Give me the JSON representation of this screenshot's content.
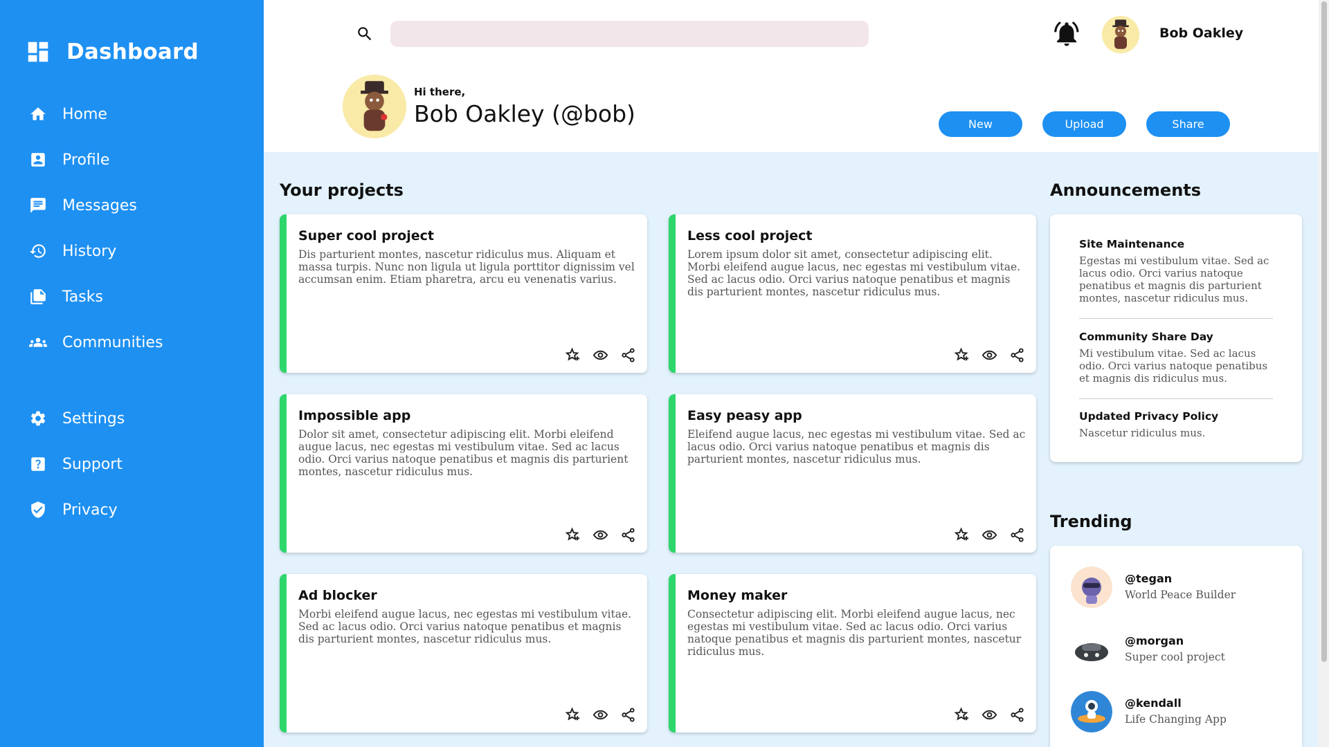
{
  "brand": {
    "title": "Dashboard",
    "icon": "dashboard-icon"
  },
  "sidebar": {
    "items": [
      {
        "label": "Home",
        "icon": "home-icon"
      },
      {
        "label": "Profile",
        "icon": "profile-icon"
      },
      {
        "label": "Messages",
        "icon": "messages-icon"
      },
      {
        "label": "History",
        "icon": "history-icon"
      },
      {
        "label": "Tasks",
        "icon": "tasks-icon"
      },
      {
        "label": "Communities",
        "icon": "communities-icon"
      }
    ],
    "secondary": [
      {
        "label": "Settings",
        "icon": "gear-icon"
      },
      {
        "label": "Support",
        "icon": "help-icon"
      },
      {
        "label": "Privacy",
        "icon": "shield-icon"
      }
    ]
  },
  "header": {
    "search_placeholder": "",
    "username": "Bob Oakley",
    "greeting": "Hi there,",
    "display_name": "Bob Oakley (@bob)",
    "buttons": {
      "new": "New",
      "upload": "Upload",
      "share": "Share"
    }
  },
  "projects": {
    "title": "Your projects",
    "items": [
      {
        "title": "Super cool project",
        "body": "Dis parturient montes, nascetur ridiculus mus. Aliquam et massa turpis. Nunc non ligula ut ligula porttitor dignissim vel accumsan enim. Etiam pharetra, arcu eu venenatis varius."
      },
      {
        "title": "Less cool project",
        "body": "Lorem ipsum dolor sit amet, consectetur adipiscing elit. Morbi eleifend augue lacus, nec egestas mi vestibulum vitae. Sed ac lacus odio. Orci varius natoque penatibus et magnis dis parturient montes, nascetur ridiculus mus."
      },
      {
        "title": "Impossible app",
        "body": "Dolor sit amet, consectetur adipiscing elit. Morbi eleifend augue lacus, nec egestas mi vestibulum vitae. Sed ac lacus odio. Orci varius natoque penatibus et magnis dis parturient montes, nascetur ridiculus mus."
      },
      {
        "title": "Easy peasy app",
        "body": "Eleifend augue lacus, nec egestas mi vestibulum vitae. Sed ac lacus odio. Orci varius natoque penatibus et magnis dis parturient montes, nascetur ridiculus mus."
      },
      {
        "title": "Ad blocker",
        "body": "Morbi eleifend augue lacus, nec egestas mi vestibulum vitae. Sed ac lacus odio. Orci varius natoque penatibus et magnis dis parturient montes, nascetur ridiculus mus."
      },
      {
        "title": "Money maker",
        "body": "Consectetur adipiscing elit. Morbi eleifend augue lacus, nec egestas mi vestibulum vitae. Sed ac lacus odio. Orci varius natoque penatibus et magnis dis parturient montes, nascetur ridiculus mus."
      }
    ]
  },
  "announcements": {
    "title": "Announcements",
    "items": [
      {
        "title": "Site Maintenance",
        "body": "Egestas mi vestibulum vitae. Sed ac lacus odio. Orci varius natoque penatibus et magnis dis parturient montes, nascetur ridiculus mus."
      },
      {
        "title": "Community Share Day",
        "body": "Mi vestibulum vitae. Sed ac lacus odio. Orci varius natoque penatibus et magnis dis ridiculus mus."
      },
      {
        "title": "Updated Privacy Policy",
        "body": "Nascetur ridiculus mus."
      }
    ]
  },
  "trending": {
    "title": "Trending",
    "items": [
      {
        "handle": "@tegan",
        "desc": "World Peace Builder"
      },
      {
        "handle": "@morgan",
        "desc": "Super cool project"
      },
      {
        "handle": "@kendall",
        "desc": "Life Changing App"
      }
    ]
  },
  "colors": {
    "sidebar": "#1e90f2",
    "accent": "#2ed66b",
    "background": "#e3f2fd"
  }
}
